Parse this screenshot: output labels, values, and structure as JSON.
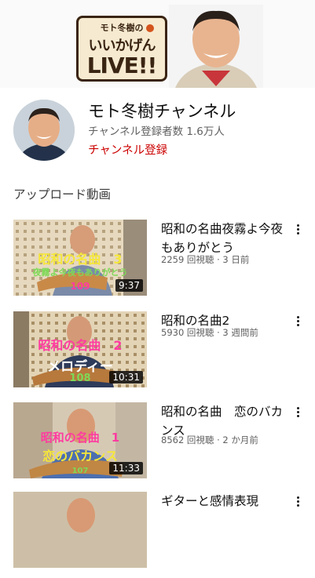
{
  "banner": {
    "logo_line1": "モト冬樹の",
    "logo_line2": "いいかげん",
    "logo_line3": "LIVE!!"
  },
  "channel": {
    "name": "モト冬樹チャンネル",
    "subscribers": "チャンネル登録者数 1.6万人",
    "subscribe_label": "チャンネル登録"
  },
  "section_title": "アップロード動画",
  "videos": [
    {
      "title": "昭和の名曲夜霧よ今夜もありがとう",
      "meta": "2259 回視聴 · 3 日前",
      "duration": "9:37",
      "overlay": [
        "昭和の名曲　3",
        "夜霧よ今夜もありがとう",
        "109"
      ]
    },
    {
      "title": "昭和の名曲2",
      "meta": "5930 回視聴 · 3 週間前",
      "duration": "10:31",
      "overlay": [
        "昭和の名曲　2",
        "メロディー",
        "108"
      ]
    },
    {
      "title": "昭和の名曲　恋のバカンス",
      "meta": "8562 回視聴 · 2 か月前",
      "duration": "11:33",
      "overlay": [
        "昭和の名曲　1",
        "恋のバカンス",
        "107"
      ]
    },
    {
      "title": "ギターと感情表現",
      "meta": "",
      "duration": "",
      "overlay": []
    }
  ],
  "colors": {
    "subscribe": "#cc0000",
    "overlay_yellow": "#f5e63a",
    "overlay_pink": "#ff3ca0",
    "overlay_green": "#7ed957"
  }
}
